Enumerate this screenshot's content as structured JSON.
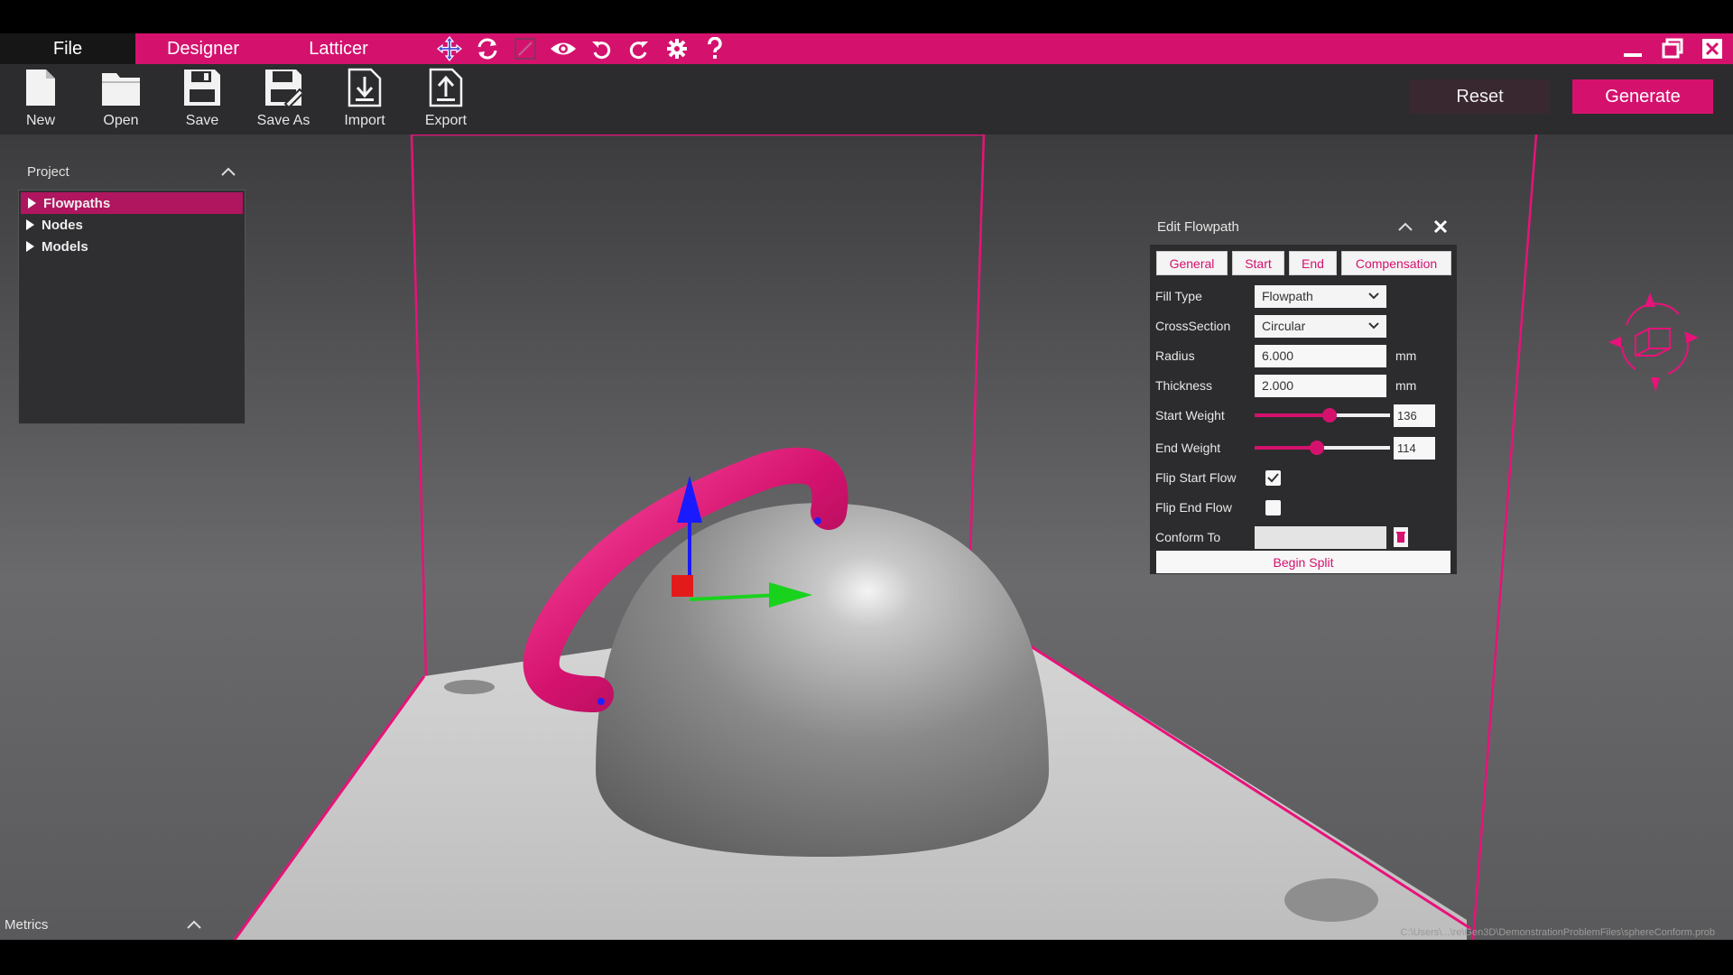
{
  "colors": {
    "accent": "#d4126e",
    "toolbar_bg": "#2c2c2e",
    "panel_bg": "#2c2c2e",
    "menubar_bg": "#d4126e"
  },
  "menu": {
    "file": "File",
    "designer": "Designer",
    "latticer": "Latticer",
    "tool_icons": [
      "move-icon",
      "rotate-icon",
      "scale-icon",
      "eye-icon",
      "undo-icon",
      "redo-icon",
      "gear-icon",
      "help-icon"
    ],
    "window_icons": [
      "minimize-icon",
      "restore-icon",
      "close-icon"
    ]
  },
  "toolbar": {
    "buttons": [
      {
        "label": "New",
        "icon": "file-new-icon"
      },
      {
        "label": "Open",
        "icon": "folder-icon"
      },
      {
        "label": "Save",
        "icon": "floppy-icon"
      },
      {
        "label": "Save As",
        "icon": "floppy-edit-icon"
      },
      {
        "label": "Import",
        "icon": "import-icon"
      },
      {
        "label": "Export",
        "icon": "export-icon"
      }
    ],
    "reset": "Reset",
    "generate": "Generate"
  },
  "project": {
    "title": "Project",
    "items": [
      {
        "label": "Flowpaths",
        "selected": true
      },
      {
        "label": "Nodes",
        "selected": false
      },
      {
        "label": "Models",
        "selected": false
      }
    ]
  },
  "edit_flowpath": {
    "title": "Edit Flowpath",
    "tabs": [
      "General",
      "Start",
      "End",
      "Compensation"
    ],
    "fill_type": {
      "label": "Fill Type",
      "value": "Flowpath"
    },
    "cross_section": {
      "label": "CrossSection",
      "value": "Circular"
    },
    "radius": {
      "label": "Radius",
      "value": "6.000",
      "unit": "mm"
    },
    "thickness": {
      "label": "Thickness",
      "value": "2.000",
      "unit": "mm"
    },
    "start_weight": {
      "label": "Start Weight",
      "value": "136",
      "fraction": 0.55
    },
    "end_weight": {
      "label": "End Weight",
      "value": "114",
      "fraction": 0.46
    },
    "flip_start_flow": {
      "label": "Flip Start Flow",
      "checked": true
    },
    "flip_end_flow": {
      "label": "Flip End Flow",
      "checked": false
    },
    "conform_to": {
      "label": "Conform To",
      "value": ""
    },
    "begin_split": "Begin Split"
  },
  "metrics": {
    "title": "Metrics"
  },
  "status": {
    "path": "C:\\Users\\...\\re\\Gen3D\\DemonstrationProblemFiles\\sphereConform.prob"
  }
}
